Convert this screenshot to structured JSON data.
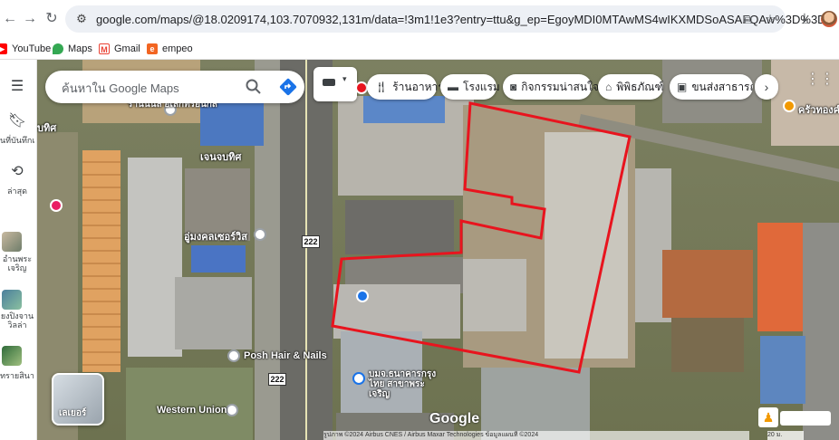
{
  "browser": {
    "url": "google.com/maps/@18.0209174,103.7070932,131m/data=!3m1!1e3?entry=ttu&g_ep=EgoyMDI0MTAwMS4wIKXMDSoASAFQAw%3D%3D",
    "bookmarks": [
      {
        "label": "YouTube",
        "icon": "youtube-icon",
        "color": "#ff0000"
      },
      {
        "label": "Maps",
        "icon": "maps-pin-icon",
        "color": "#34a853"
      },
      {
        "label": "Gmail",
        "icon": "gmail-icon",
        "color": "#ea4335"
      },
      {
        "label": "empeo",
        "icon": "empeo-icon",
        "color": "#f26522"
      }
    ]
  },
  "sidebar": {
    "saved_label": "นที่บันทึกแล้ว",
    "recent_label": "ล่าสุด",
    "item1_label": "อำนพระเจริญ",
    "item2_label": "ยงปิงจานวิลล่า",
    "item3_label": "ทรายสินา"
  },
  "search": {
    "placeholder": "ค้นหาใน Google Maps"
  },
  "chips": [
    {
      "label": "ร้านอาหาร",
      "icon": "restaurant-icon"
    },
    {
      "label": "โรงแรม",
      "icon": "hotel-icon"
    },
    {
      "label": "กิจกรรมน่าสนใจ",
      "icon": "camera-icon"
    },
    {
      "label": "พิพิธภัณฑ์",
      "icon": "museum-icon"
    },
    {
      "label": "ขนส่งสาธารณะ",
      "icon": "transit-icon"
    }
  ],
  "map": {
    "pois": {
      "p1": "ร้านนีนิล อิเล็กทรอนิกส์",
      "p2": "เจนจบทิศ",
      "p3": "อู่มงคลเซอร์วิส",
      "p4": "Posh Hair & Nails",
      "p5": "Western Union",
      "p6": "บมจ.ธนาคารกรุงไทย สาขาพระเจริญ",
      "p7": "ครัวทองคำ",
      "p8": "บทิศ"
    },
    "road_number": "222",
    "layers_label": "เลเยอร์",
    "google_logo": "Google",
    "attribution": "รูปภาพ ©2024 Airbus CNES / Airbus Maxar Technologies ข้อมูลแผนที่ ©2024",
    "scale": "20 ม."
  },
  "colors": {
    "highlight": "#e8141e",
    "accent": "#1a73e8"
  }
}
